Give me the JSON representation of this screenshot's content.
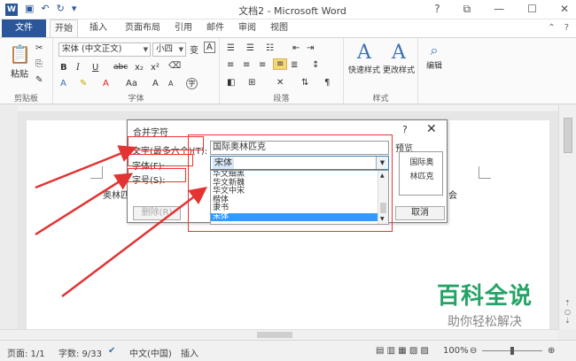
{
  "titlebar": {
    "app_icon": "W",
    "window_title": "文档2 - Microsoft Word",
    "qat_icons": [
      "save-icon",
      "undo-icon",
      "redo-icon",
      "customize-icon"
    ],
    "help": "?",
    "restore": "⧉",
    "minimize": "—",
    "maximize": "☐",
    "close": "✕"
  },
  "tabs": {
    "file": "文件",
    "items": [
      "开始",
      "插入",
      "页面布局",
      "引用",
      "邮件",
      "审阅",
      "视图"
    ],
    "active": "开始"
  },
  "ribbon": {
    "clipboard": {
      "paste": "粘贴",
      "label": "剪贴板"
    },
    "font": {
      "font_name": "宋体 (中文正文)",
      "font_size": "小四",
      "label": "字体",
      "buttons": [
        "B",
        "I",
        "U",
        "abc",
        "x₂",
        "x²",
        "A",
        "Aa",
        "A",
        "A"
      ]
    },
    "paragraph": {
      "label": "段落"
    },
    "styles": {
      "quick": "快速样式",
      "change": "更改样式",
      "label": "样式"
    },
    "editing": {
      "label": "编辑"
    }
  },
  "dialog": {
    "title": "合并字符",
    "help": "?",
    "close": "✕",
    "text_label": "文字(最多六个)(T):",
    "text_value": "国际奥林匹克",
    "preview_label": "预览",
    "preview_lines": [
      "国际奥",
      "林匹克"
    ],
    "font_label": "字体(F):",
    "font_value": "宋体",
    "size_label": "字号(S):",
    "font_list": [
      "华文细黑",
      "华文新魏",
      "华文中宋",
      "楷体",
      "隶书",
      "宋体"
    ],
    "selected_font": "宋体",
    "remove_button": "删除(R)",
    "cancel_button": "取消"
  },
  "document": {
    "left_text": "奥林匹",
    "right_text": "会"
  },
  "statusbar": {
    "page": "页面: 1/1",
    "words": "字数: 9/33",
    "language": "中文(中国)",
    "insert": "插入",
    "zoom": "100%"
  },
  "watermark": {
    "line1": "百科全说",
    "line2": "助你轻松解决"
  },
  "colors": {
    "word_blue": "#2b579a",
    "selection_blue": "#3399ff",
    "annotation_red": "#e33333",
    "watermark_green": "#24a366"
  }
}
